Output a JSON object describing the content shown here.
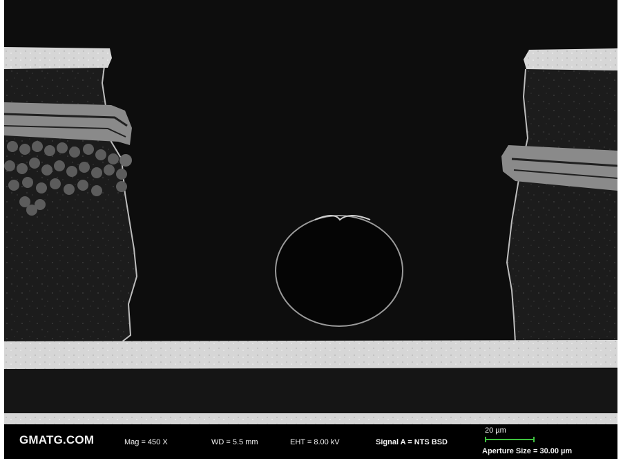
{
  "image": {
    "description": "Scanning electron microscope cross-section of a PCB via with plated layers",
    "colors": {
      "background": "#0d0d0d",
      "copper": "#d8d8d8",
      "laminate": "#1e1e1e",
      "glass_fiber": "#555555",
      "infobar": "#000000",
      "scalebar": "#3ec23e"
    }
  },
  "infobar": {
    "logo": "GMATG.COM",
    "mag": "Mag =    450 X",
    "wd": "WD =  5.5 mm",
    "eht": "EHT =  8.00 kV",
    "signal": "Signal A = NTS BSD",
    "scale": "20 µm",
    "aperture": "Aperture Size = 30.00 µm"
  }
}
